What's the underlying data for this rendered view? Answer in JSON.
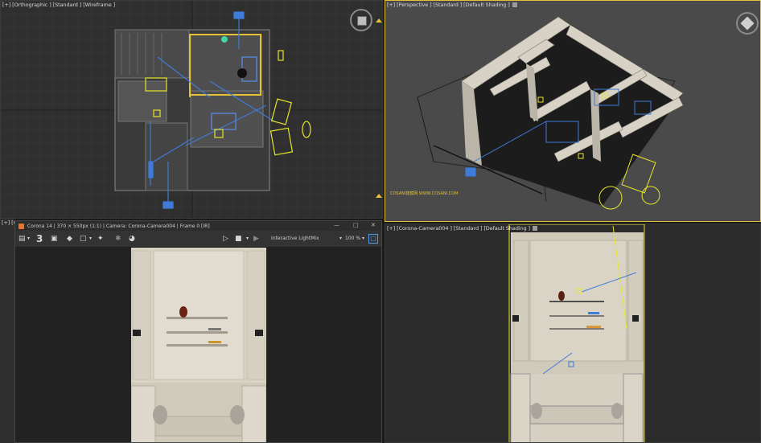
{
  "viewports": {
    "top_left": {
      "label": "[+] [Orthographic ] [Standard ] [Wireframe ]"
    },
    "top_right": {
      "label": "[+] [Perspective ] [Standard ] [Default Shading ]",
      "watermark": "COSANI建模网 WWW.COSANI.COM"
    },
    "bottom_right": {
      "label": "[+] [Corona-Camera004 ] [Standard ] [Default Shading ]"
    },
    "bottom_left": {
      "label": "[+] [C"
    }
  },
  "vfb": {
    "title": "Corona 14 | 370 × 550px (1:1) | Camera: Corona-Camera004 | Frame 0 [IR]",
    "pass_number": "3",
    "lightmix": "Interactive LightMix",
    "zoom": "100 %",
    "minimize": "—",
    "maximize": "□",
    "close": "✕"
  },
  "colors": {
    "accent_yellow": "#e3c23a",
    "gizmo_blue": "#3f7bd8",
    "light_yellow": "#e6e62a"
  },
  "icons": [
    "save-icon",
    "chevron-down-icon",
    "pass-counter",
    "region-icon",
    "eraser-icon",
    "region-select-icon",
    "picker-icon",
    "denoise-icon",
    "corona-logo-icon",
    "play-icon",
    "stop-icon",
    "play-ir-icon",
    "dropdown-icon",
    "panel-toggle-icon",
    "viewcube-icon"
  ]
}
